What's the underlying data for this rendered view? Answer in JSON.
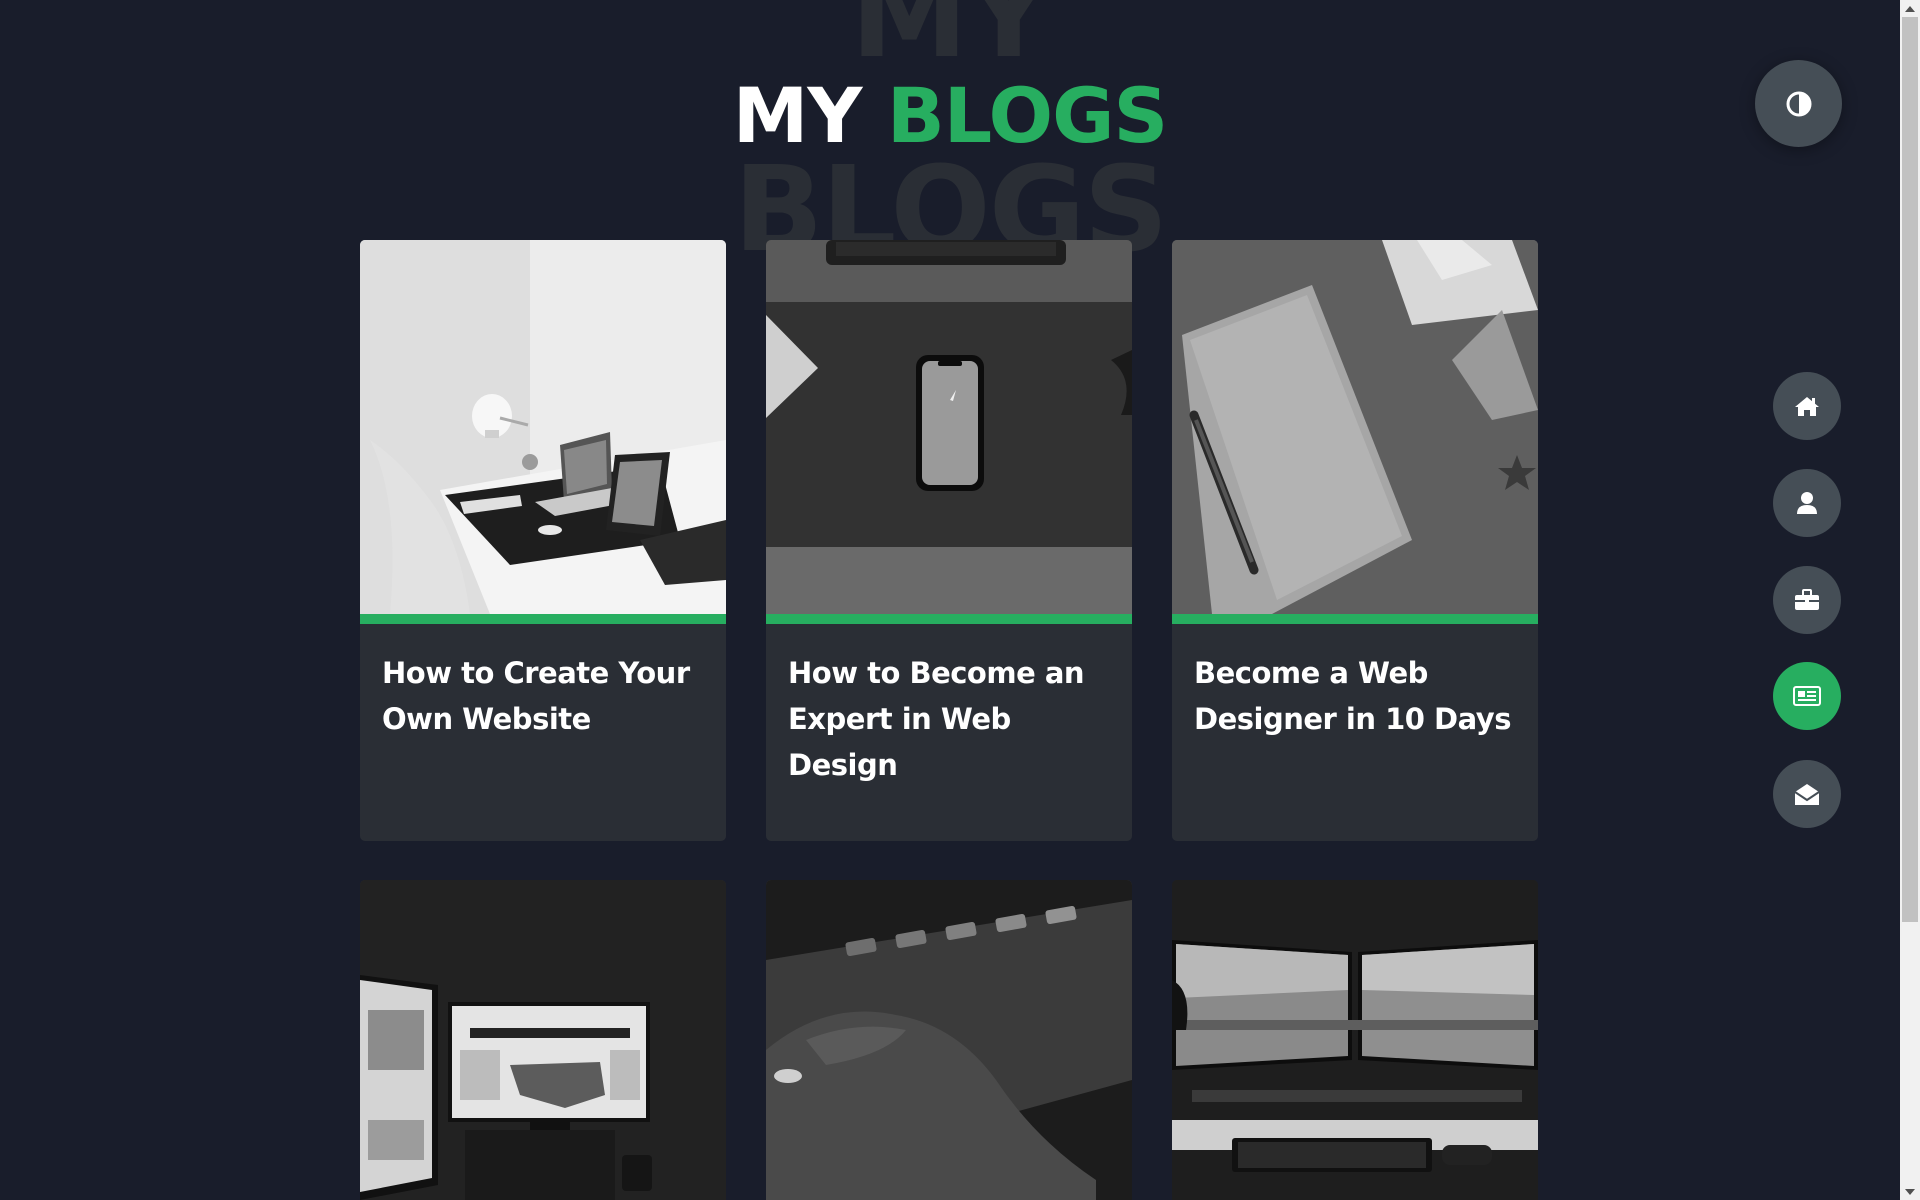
{
  "header": {
    "title_part1": "MY",
    "title_part2": "BLOGS",
    "bg_word_1": "MY",
    "bg_word_2": "BLOGS"
  },
  "blogs": [
    {
      "title": "How to Create Your Own Website",
      "image": "white-desk-laptop-tablet"
    },
    {
      "title": "How to Become an Expert in Web Design",
      "image": "phone-on-desk-mat"
    },
    {
      "title": "Become a Web Designer in 10 Days",
      "image": "notebook-and-pen"
    },
    {
      "title": "",
      "image": "monitors-news"
    },
    {
      "title": "",
      "image": "hand-on-keyboard"
    },
    {
      "title": "",
      "image": "dual-monitor-setup"
    }
  ],
  "theme_toggle": {
    "icon": "contrast-icon"
  },
  "nav": [
    {
      "name": "home",
      "icon": "home-icon",
      "active": false
    },
    {
      "name": "about",
      "icon": "user-icon",
      "active": false
    },
    {
      "name": "portfolio",
      "icon": "briefcase-icon",
      "active": false
    },
    {
      "name": "blogs",
      "icon": "newspaper-icon",
      "active": true
    },
    {
      "name": "contact",
      "icon": "envelope-open-icon",
      "active": false
    }
  ],
  "colors": {
    "background": "#191d2b",
    "card": "#2a2e35",
    "accent": "#27ae60",
    "button": "#454e56",
    "heading_shadow": "#2a2e35"
  }
}
